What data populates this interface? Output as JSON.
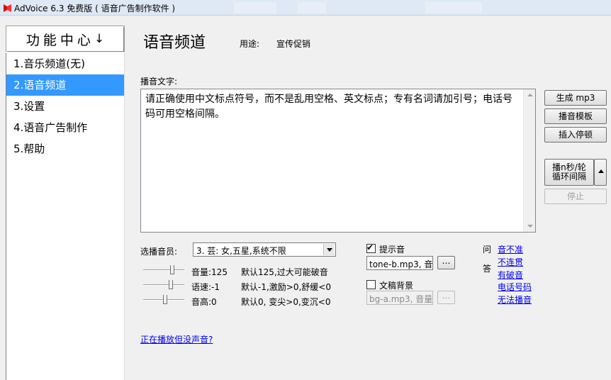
{
  "window": {
    "title": "AdVoice 6.3 免费版 ( 语音广告制作软件 )"
  },
  "sidebar": {
    "header": "功能中心",
    "header_arrow": "↓",
    "items": [
      {
        "label": "1.音乐频道(无)"
      },
      {
        "label": "2.语音频道"
      },
      {
        "label": "3.设置"
      },
      {
        "label": "4.语音广告制作"
      },
      {
        "label": "5.帮助"
      }
    ]
  },
  "main": {
    "title": "语音频道",
    "usage_label": "用途:",
    "usage_value": "宣传促销",
    "text_label": "播音文字:",
    "text_content": "请正确使用中文标点符号，而不是乱用空格、英文标点；专有名词请加引号；电话号码可用空格间隔。",
    "buttons": {
      "generate": "生成 mp3",
      "template": "播音模板",
      "insert_pause": "插入停顿",
      "play_line1": "播n秒/轮",
      "play_line2": "循环间隔",
      "stop": "停止"
    },
    "voice_label": "选播音员:",
    "voice_value": "3. 芸: 女,五星,系统不限",
    "volume": {
      "label": "音量:125",
      "hint": "默认125,过大可能破音"
    },
    "speed": {
      "label": "语速:-1",
      "hint": "默认-1,激励>0,舒缓<0"
    },
    "pitch": {
      "label": "音高:0",
      "hint": "默认0, 变尖>0,变沉<0"
    },
    "tone": {
      "label": "提示音",
      "checked": true,
      "file": "tone-b.mp3, 音",
      "browse": "…"
    },
    "background": {
      "label": "文稿背景",
      "checked": false,
      "file": "bg-a.mp3, 音量",
      "browse": "…"
    },
    "qa_label_1": "问",
    "qa_label_2": "答",
    "qa_links": [
      "音不准",
      "不连贯",
      "有破音",
      "电话号码",
      "无法播音"
    ],
    "help_link": "正在播放但没声音?"
  },
  "colors": {
    "selected": "#3399ff",
    "link": "#0000ee"
  }
}
